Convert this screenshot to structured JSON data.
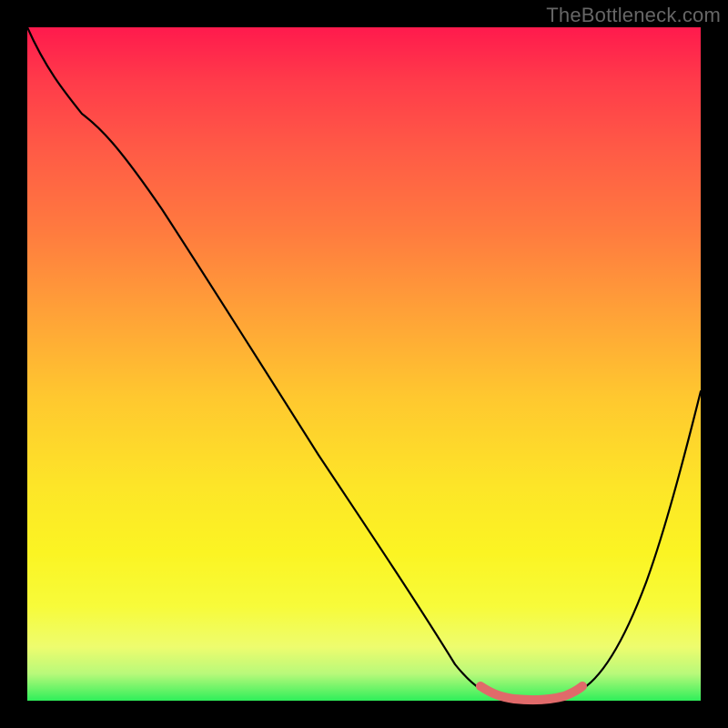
{
  "watermark": "TheBottleneck.com",
  "colors": {
    "background": "#000000",
    "curve": "#000000",
    "highlight": "#e06a6a",
    "gradient_stops": [
      "#ff1a4d",
      "#ff3b4a",
      "#ff5a46",
      "#ff7a3f",
      "#ffa038",
      "#ffc82f",
      "#fde528",
      "#fbf423",
      "#f7fb3a",
      "#eefc6e",
      "#b8f97a",
      "#2fef5a"
    ]
  },
  "chart_data": {
    "type": "line",
    "title": "",
    "xlabel": "",
    "ylabel": "",
    "xlim": [
      0,
      100
    ],
    "ylim": [
      0,
      100
    ],
    "grid": false,
    "legend": "none",
    "series": [
      {
        "name": "curve",
        "x": [
          0,
          4,
          8,
          14,
          20,
          30,
          40,
          50,
          60,
          64,
          69,
          72,
          75,
          78,
          82,
          86,
          92,
          96,
          100
        ],
        "y": [
          100,
          95,
          90,
          87,
          82,
          67,
          52,
          37,
          20,
          12,
          3,
          1,
          0,
          0,
          1,
          5,
          18,
          33,
          46
        ]
      }
    ],
    "annotations": [
      {
        "name": "optimal-range",
        "x_start": 69,
        "x_end": 82,
        "y_approx": 0
      }
    ]
  }
}
